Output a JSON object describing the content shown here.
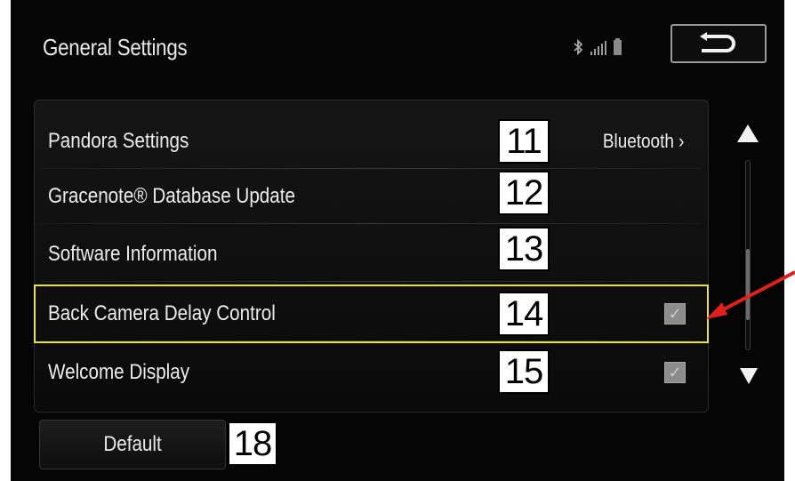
{
  "header": {
    "title": "General Settings",
    "status_icons": [
      "bluetooth-icon",
      "signal-icon",
      "battery-icon"
    ],
    "back_icon": "return-arrow-icon"
  },
  "list": {
    "rows": [
      {
        "label": "Pandora Settings",
        "value": "Bluetooth ›",
        "callout": "11"
      },
      {
        "label": "Gracenote® Database Update",
        "callout": "12"
      },
      {
        "label": "Software Information",
        "callout": "13"
      },
      {
        "label": "Back Camera Delay Control",
        "checked": true,
        "callout": "14",
        "highlighted": true
      },
      {
        "label": "Welcome Display",
        "checked": true,
        "callout": "15"
      }
    ]
  },
  "scrollbar": {
    "position": 0.75
  },
  "footer": {
    "default_label": "Default",
    "callout": "18"
  },
  "colors": {
    "background": "#050505",
    "text": "#ececec",
    "highlight_border": "#e6e24a",
    "annotation_arrow": "#e0201c",
    "checkbox": "#8c8c8c"
  }
}
